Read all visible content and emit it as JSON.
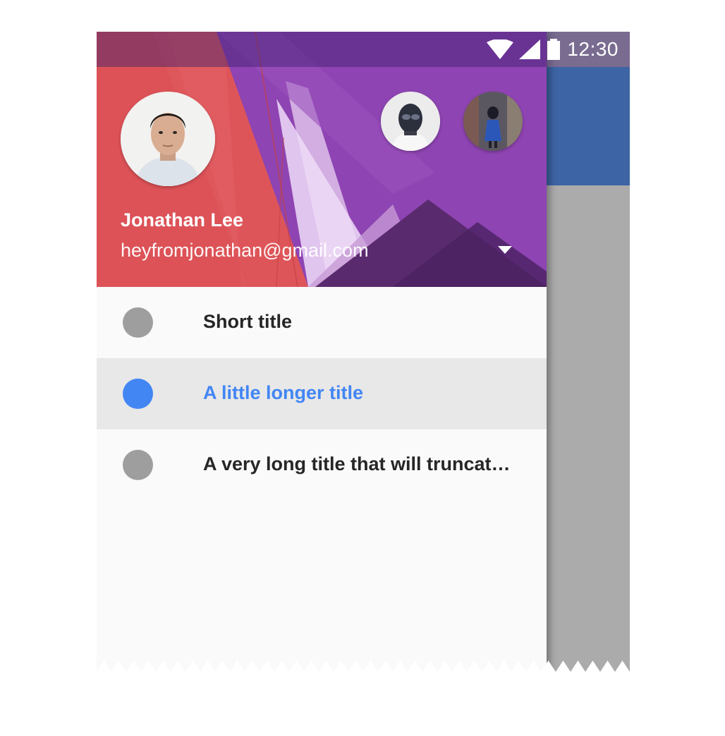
{
  "status_bar": {
    "time": "12:30",
    "icons": [
      "wifi-icon",
      "signal-icon",
      "battery-icon"
    ]
  },
  "account": {
    "name": "Jonathan Lee",
    "email": "heyfromjonathan@gmail.com",
    "avatars": [
      "avatar-current-account",
      "avatar-other-account-1",
      "avatar-other-account-2"
    ],
    "dropdown_icon": "arrow-drop-down-icon"
  },
  "nav": {
    "items": [
      {
        "label": "Short title",
        "selected": false
      },
      {
        "label": "A little longer title",
        "selected": true
      },
      {
        "label": "A very long title that will truncat…",
        "selected": false
      }
    ]
  },
  "colors": {
    "header_red": "#e0555a",
    "header_purple": "#8e42b0",
    "app_bar": "#3d64a4",
    "scrim": "#ababab",
    "accent_blue": "#4286f4",
    "inactive_dot": "#9e9e9e",
    "selected_row": "#e8e8e8"
  }
}
